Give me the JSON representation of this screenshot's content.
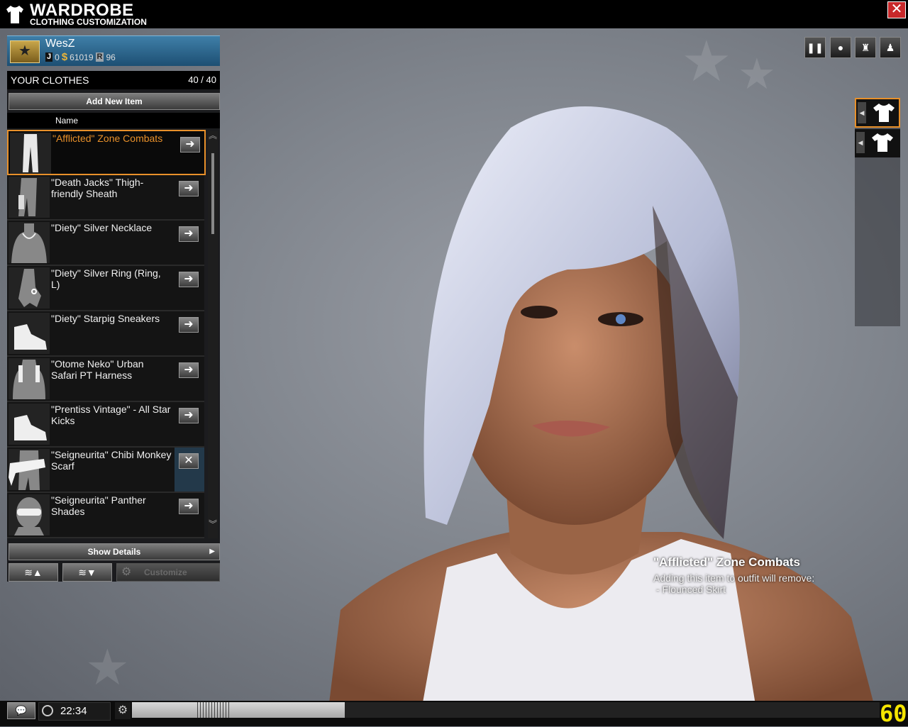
{
  "window": {
    "title": "WARDROBE",
    "subtitle": "CLOTHING CUSTOMIZATION",
    "close_glyph": "✕"
  },
  "player": {
    "name": "WesZ",
    "stat_j_label": "J",
    "stat_j_value": "0",
    "currency_symbol": "$",
    "currency_value": "61019",
    "stat_r_label": "R",
    "stat_r_value": "96",
    "rank_icon": "star-icon"
  },
  "clothes": {
    "title": "YOUR CLOTHES",
    "count": "40 / 40",
    "add_button": "Add New Item",
    "column_name": "Name",
    "items": [
      {
        "name": "\"Afflicted\" Zone Combats",
        "icon": "pants-icon",
        "action": "➜",
        "selected": true
      },
      {
        "name": "\"Death Jacks\" Thigh-friendly Sheath",
        "icon": "thigh-sheath-icon",
        "action": "➜"
      },
      {
        "name": "\"Diety\" Silver Necklace",
        "icon": "necklace-icon",
        "action": "➜"
      },
      {
        "name": "\"Diety\" Silver Ring (Ring, L)",
        "icon": "ring-hand-icon",
        "action": "➜"
      },
      {
        "name": "\"Diety\" Starpig Sneakers",
        "icon": "sneaker-icon",
        "action": "➜"
      },
      {
        "name": "\"Otome Neko\" Urban Safari PT Harness",
        "icon": "harness-icon",
        "action": "➜"
      },
      {
        "name": "\"Prentiss Vintage\" - All Star Kicks",
        "icon": "sneaker-icon",
        "action": "➜"
      },
      {
        "name": "\"Seigneurita\" Chibi Monkey Scarf",
        "icon": "scarf-icon",
        "action": "✕"
      },
      {
        "name": "\"Seigneurita\" Panther Shades",
        "icon": "shades-icon",
        "action": "➜"
      }
    ],
    "show_details": "Show Details",
    "customize": "Customize"
  },
  "view_controls": [
    {
      "name": "pause",
      "glyph": "❚❚"
    },
    {
      "name": "head",
      "glyph": "●"
    },
    {
      "name": "upper-body",
      "glyph": "♜"
    },
    {
      "name": "full-body",
      "glyph": "♟"
    }
  ],
  "outfit_slots": [
    {
      "icon": "tshirt-icon",
      "active": true
    },
    {
      "icon": "tshirt-icon",
      "active": false
    }
  ],
  "tooltip": {
    "title": "\"Afflicted\" Zone Combats",
    "line1": "Adding this item to outfit will remove:",
    "line2": "- Flounced Skirt"
  },
  "status_bar": {
    "time": "22:34",
    "fps": "60",
    "progress": 0.285
  }
}
